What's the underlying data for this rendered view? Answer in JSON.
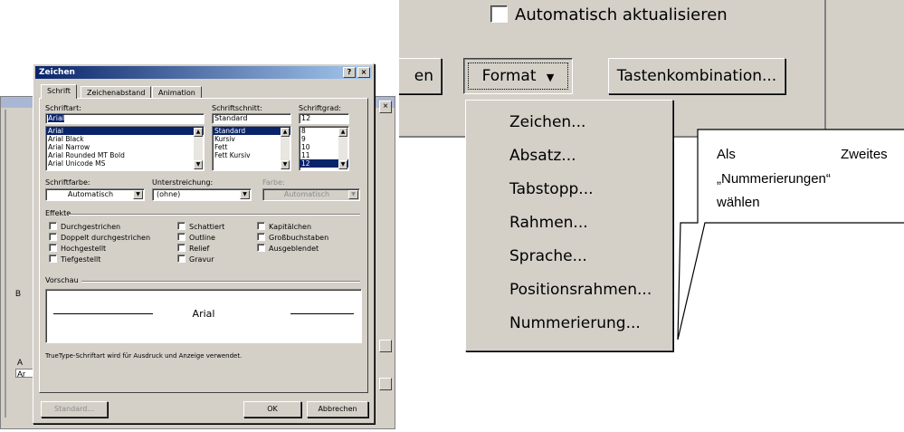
{
  "zeichen_dialog": {
    "title": "Zeichen",
    "help_btn": "?",
    "close_btn": "×",
    "tabs": [
      "Schrift",
      "Zeichenabstand",
      "Animation"
    ],
    "font_label": "Schriftart:",
    "font_value": "Arial",
    "font_list": [
      "Arial",
      "Arial Black",
      "Arial Narrow",
      "Arial Rounded MT Bold",
      "Arial Unicode MS"
    ],
    "style_label": "Schriftschnitt:",
    "style_value": "Standard",
    "style_list": [
      "Standard",
      "Kursiv",
      "Fett",
      "Fett Kursiv"
    ],
    "size_label": "Schriftgrad:",
    "size_value": "12",
    "size_list": [
      "8",
      "9",
      "10",
      "11",
      "12"
    ],
    "color_label": "Schriftfarbe:",
    "color_value": "Automatisch",
    "underline_label": "Unterstreichung:",
    "underline_value": "(ohne)",
    "underline_color_label": "Farbe:",
    "underline_color_value": "Automatisch",
    "effects_label": "Effekte",
    "effects": [
      "Durchgestrichen",
      "Doppelt durchgestrichen",
      "Hochgestellt",
      "Tiefgestellt",
      "Schattiert",
      "Outline",
      "Relief",
      "Gravur",
      "Kapitälchen",
      "Großbuchstaben",
      "Ausgeblendet"
    ],
    "preview_label": "Vorschau",
    "preview_text": "Arial",
    "info_text": "TrueType-Schriftart wird für Ausdruck und Anzeige verwendet.",
    "buttons": {
      "standard": "Standard...",
      "ok": "OK",
      "cancel": "Abbrechen"
    }
  },
  "bg_window": {
    "fragments": [
      "A",
      "Ar",
      "AR",
      "B"
    ]
  },
  "format_ui": {
    "auto_update_label": "Automatisch aktualisieren",
    "partial_button": "en",
    "format_button": "Format",
    "format_arrow": "▼",
    "shortcut_button": "Tastenkombination...",
    "menu_items": [
      "Zeichen...",
      "Absatz...",
      "Tabstopp...",
      "Rahmen...",
      "Sprache...",
      "Positionsrahmen...",
      "Nummerierung..."
    ]
  },
  "callout": {
    "line1_left": "Als",
    "line1_right": "Zweites",
    "line2": "„Nummerierungen“",
    "line3": "wählen"
  },
  "colors": {
    "dialog_face": "#d4d0c8",
    "title_active": "#0a246a",
    "selection": "#0a246a"
  }
}
